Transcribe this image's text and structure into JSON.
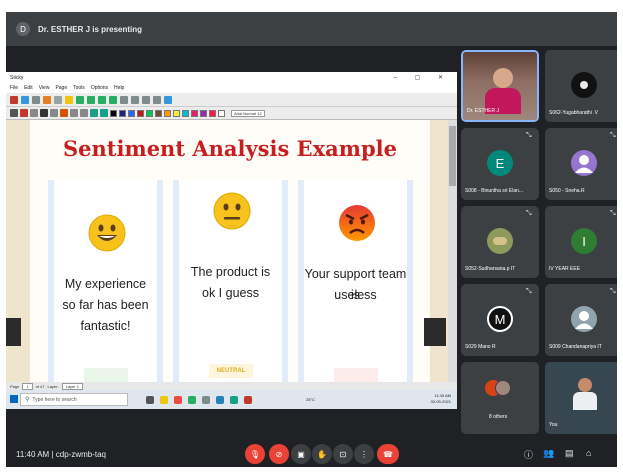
{
  "meeting": {
    "presenter_initial": "D",
    "presenting_text": "Dr. ESTHER J is presenting",
    "time": "11:40 AM",
    "separator": "|",
    "meeting_code": "cdp-zwmb-taq"
  },
  "app": {
    "title": "Sticky",
    "menu": [
      "File",
      "Edit",
      "View",
      "Page",
      "Tools",
      "Options",
      "Help"
    ],
    "font_box": "Arial Normal  12",
    "statusbar": {
      "page_label": "Page",
      "page_value": "1",
      "page_total": "of 47",
      "layer_label": "Layer:",
      "layer_value": "Layer 1"
    }
  },
  "slide": {
    "title": "Sentiment Analysis Example",
    "cards": [
      {
        "text_lines": [
          "My experience",
          "so far has been",
          "fantastic!"
        ],
        "badge": "",
        "sentiment": "positive"
      },
      {
        "text_lines": [
          "The product is",
          "ok I guess"
        ],
        "badge": "NEUTRAL",
        "sentiment": "neutral"
      },
      {
        "text_lines": [
          "Your support team is",
          "useless"
        ],
        "badge": "",
        "sentiment": "negative"
      }
    ]
  },
  "taskbar": {
    "search_placeholder": "Type here to search",
    "weather": "28°C",
    "tray_time": "11:40 AM",
    "tray_date": "30-09-2021"
  },
  "tiles": [
    {
      "name": "Dr. ESTHER J",
      "initial": "",
      "color": "#6b4a3a",
      "kind": "video"
    },
    {
      "name": "S062-Yugabharathi .V",
      "initial": "",
      "color": "#111111",
      "kind": "photo"
    },
    {
      "name": "S008 - Binuntha sri Elan...",
      "initial": "E",
      "color": "#00897b",
      "kind": "letter"
    },
    {
      "name": "S050 - Sneha.R",
      "initial": "",
      "color": "#9575cd",
      "kind": "person"
    },
    {
      "name": "S052-Sudharsana.p IT",
      "initial": "",
      "color": "#8d9a5b",
      "kind": "photo"
    },
    {
      "name": "IV YEAR EEE",
      "initial": "I",
      "color": "#2e7d32",
      "kind": "letter"
    },
    {
      "name": "S029 Mano R",
      "initial": "M",
      "color": "#111111",
      "kind": "letter"
    },
    {
      "name": "S009 Chandanapriya IT",
      "initial": "",
      "color": "#90a4ae",
      "kind": "person"
    },
    {
      "name": "8 others",
      "initial": "",
      "color": "#3c4043",
      "kind": "others"
    },
    {
      "name": "You",
      "initial": "",
      "color": "#cfd8dc",
      "kind": "photo"
    }
  ],
  "colors": {
    "meet_bg": "#202124",
    "tile_bg": "#3c4043",
    "red": "#ea4335",
    "slide_title": "#c71f1f"
  }
}
